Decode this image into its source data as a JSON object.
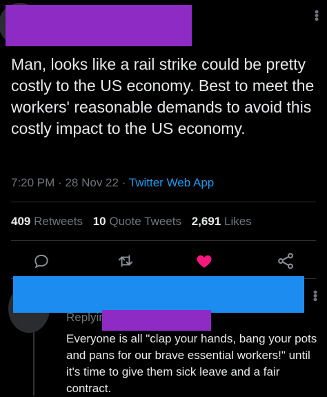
{
  "tweet": {
    "text": "Man, looks like a rail strike could be pretty costly to the US economy. Best to meet the workers' reasonable demands to avoid this costly impact to the US economy.",
    "time": "7:20 PM",
    "date": "28 Nov 22",
    "separator": "·",
    "source": "Twitter Web App"
  },
  "stats": {
    "retweets_count": "409",
    "retweets_label": "Retweets",
    "quotes_count": "10",
    "quotes_label": "Quote Tweets",
    "likes_count": "2,691",
    "likes_label": "Likes"
  },
  "actions": {
    "reply_icon": "reply-icon",
    "retweet_icon": "retweet-icon",
    "like_icon": "heart-icon",
    "share_icon": "share-icon",
    "like_color": "#f91880"
  },
  "reply": {
    "replying_label": "Replyin",
    "text": "Everyone is all \"clap your hands, bang your pots and pans for our brave essential workers!\" until it's time to give them sick leave and a fair contract."
  },
  "colors": {
    "background": "#000000",
    "text": "#e7e9ea",
    "muted": "#71767b",
    "link": "#1d9bf0",
    "redact_purple": "#8e2bc5",
    "redact_blue": "#1d8cf0"
  }
}
